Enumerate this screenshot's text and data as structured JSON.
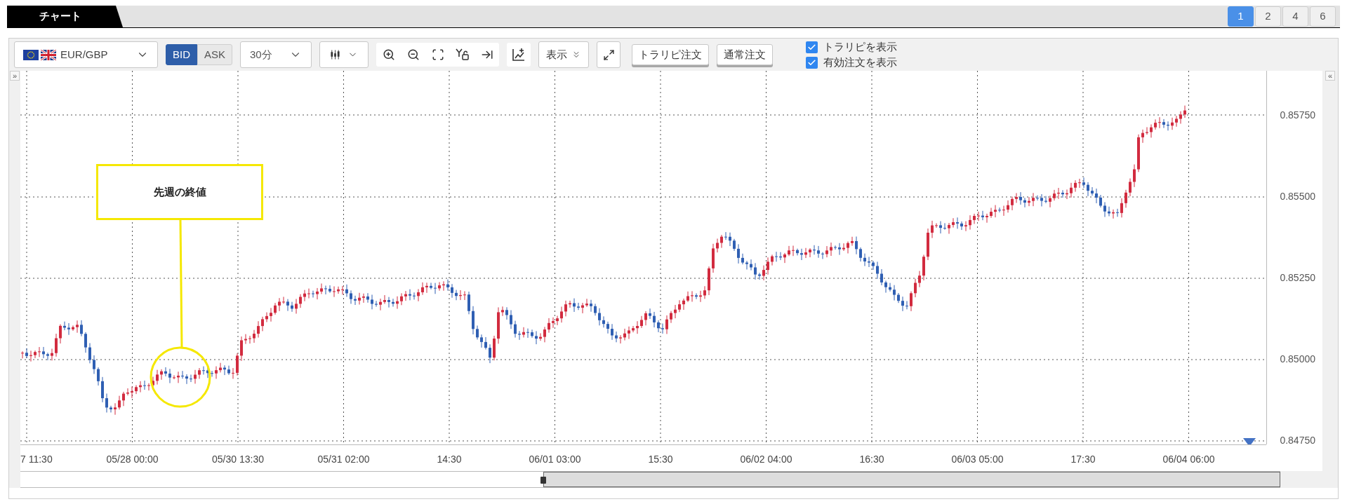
{
  "tab": {
    "label": "チャート"
  },
  "layout_buttons": [
    {
      "label": "1",
      "selected": true
    },
    {
      "label": "2",
      "selected": false
    },
    {
      "label": "4",
      "selected": false
    },
    {
      "label": "6",
      "selected": false
    }
  ],
  "toolbar": {
    "pair": {
      "value": "EUR/GBP"
    },
    "price_side": [
      {
        "label": "BID",
        "selected": true
      },
      {
        "label": "ASK",
        "selected": false
      }
    ],
    "timeframe": {
      "value": "30分"
    },
    "display_menu": {
      "label": "表示"
    },
    "order_buttons": [
      "トラリピ注文",
      "通常注文"
    ],
    "checkboxes": [
      {
        "label": "トラリピを表示",
        "checked": true
      },
      {
        "label": "有効注文を表示",
        "checked": true
      }
    ]
  },
  "chart": {
    "left_toggle": "»",
    "right_toggle": "«",
    "y_axis_labels": [
      "0.85750",
      "0.85500",
      "0.85250",
      "0.85000",
      "0.84750"
    ],
    "x_axis_labels": [
      "7 11:30",
      "05/28 00:00",
      "05/30 13:30",
      "05/31 02:00",
      "14:30",
      "06/01 03:00",
      "15:30",
      "06/02 04:00",
      "16:30",
      "06/03 05:00",
      "17:30",
      "06/04 06:00"
    ],
    "annotation": {
      "label": "先週の終値"
    }
  }
}
